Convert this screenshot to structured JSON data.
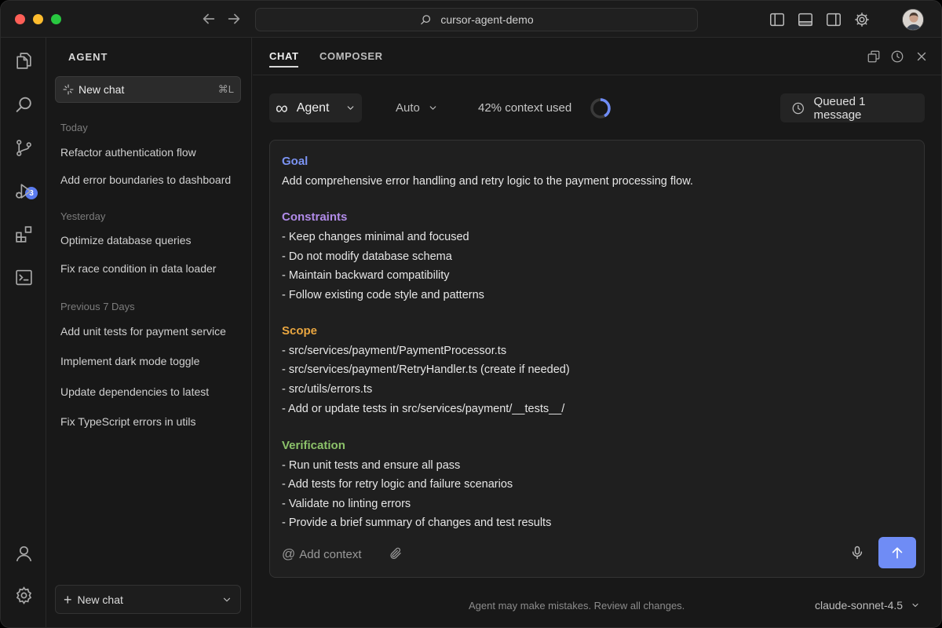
{
  "titlebar": {
    "search_text": "cursor-agent-demo"
  },
  "activity_bar": {
    "source_control_badge": "3"
  },
  "sidebar": {
    "title": "AGENT",
    "new_chat_label": "New chat",
    "new_chat_shortcut": "⌘L",
    "groups": [
      {
        "label": "Today",
        "items": [
          "Refactor authentication flow",
          "Add error boundaries to dashboard"
        ]
      },
      {
        "label": "Yesterday",
        "items": [
          "Optimize database queries",
          "Fix race condition in data loader"
        ]
      },
      {
        "label": "Previous 7 Days",
        "items": [
          "Add unit tests for payment service",
          "Implement dark mode toggle",
          "Update dependencies to latest",
          "Fix TypeScript errors in utils"
        ]
      }
    ],
    "bottom_new_chat_label": "New chat"
  },
  "tabs": [
    {
      "label": "CHAT",
      "active": true
    },
    {
      "label": "COMPOSER",
      "active": false
    }
  ],
  "toolbar": {
    "mode_label": "Agent",
    "model_select_label": "Auto",
    "context_text": "42% context used",
    "context_fraction": 0.42,
    "queued_label": "Queued 1 message"
  },
  "prompt": {
    "sections": [
      {
        "heading": "Goal",
        "color": "#7b93f2",
        "lines": [
          "Add comprehensive error handling and retry logic to the payment processing flow."
        ]
      },
      {
        "heading": "Constraints",
        "color": "#b18be8",
        "lines": [
          "- Keep changes minimal and focused",
          "- Do not modify database schema",
          "- Maintain backward compatibility",
          "- Follow existing code style and patterns"
        ]
      },
      {
        "heading": "Scope",
        "color": "#e9a640",
        "lines": [
          "- src/services/payment/PaymentProcessor.ts",
          "- src/services/payment/RetryHandler.ts (create if needed)",
          "- src/utils/errors.ts",
          "- Add or update tests in src/services/payment/__tests__/"
        ]
      },
      {
        "heading": "Verification",
        "color": "#8cc26a",
        "lines": [
          "- Run unit tests and ensure all pass",
          "- Add tests for retry logic and failure scenarios",
          "- Validate no linting errors",
          "- Provide a brief summary of changes and test results"
        ]
      }
    ],
    "add_context_label": "Add context",
    "add_context_symbol": "@"
  },
  "footer": {
    "disclaimer": "Agent may make mistakes. Review all changes.",
    "model_name": "claude-sonnet-4.5"
  },
  "colors": {
    "accent": "#6f8cf5",
    "background": "#181818",
    "panel": "#1f1f1f"
  }
}
